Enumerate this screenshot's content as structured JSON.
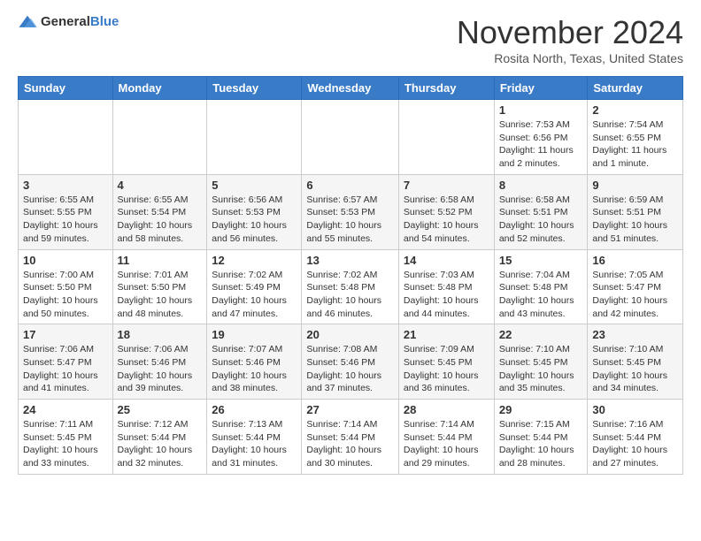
{
  "header": {
    "logo_general": "General",
    "logo_blue": "Blue",
    "month": "November 2024",
    "location": "Rosita North, Texas, United States"
  },
  "days_of_week": [
    "Sunday",
    "Monday",
    "Tuesday",
    "Wednesday",
    "Thursday",
    "Friday",
    "Saturday"
  ],
  "weeks": [
    [
      {
        "day": "",
        "info": ""
      },
      {
        "day": "",
        "info": ""
      },
      {
        "day": "",
        "info": ""
      },
      {
        "day": "",
        "info": ""
      },
      {
        "day": "",
        "info": ""
      },
      {
        "day": "1",
        "info": "Sunrise: 7:53 AM\nSunset: 6:56 PM\nDaylight: 11 hours and 2 minutes."
      },
      {
        "day": "2",
        "info": "Sunrise: 7:54 AM\nSunset: 6:55 PM\nDaylight: 11 hours and 1 minute."
      }
    ],
    [
      {
        "day": "3",
        "info": "Sunrise: 6:55 AM\nSunset: 5:55 PM\nDaylight: 10 hours and 59 minutes."
      },
      {
        "day": "4",
        "info": "Sunrise: 6:55 AM\nSunset: 5:54 PM\nDaylight: 10 hours and 58 minutes."
      },
      {
        "day": "5",
        "info": "Sunrise: 6:56 AM\nSunset: 5:53 PM\nDaylight: 10 hours and 56 minutes."
      },
      {
        "day": "6",
        "info": "Sunrise: 6:57 AM\nSunset: 5:53 PM\nDaylight: 10 hours and 55 minutes."
      },
      {
        "day": "7",
        "info": "Sunrise: 6:58 AM\nSunset: 5:52 PM\nDaylight: 10 hours and 54 minutes."
      },
      {
        "day": "8",
        "info": "Sunrise: 6:58 AM\nSunset: 5:51 PM\nDaylight: 10 hours and 52 minutes."
      },
      {
        "day": "9",
        "info": "Sunrise: 6:59 AM\nSunset: 5:51 PM\nDaylight: 10 hours and 51 minutes."
      }
    ],
    [
      {
        "day": "10",
        "info": "Sunrise: 7:00 AM\nSunset: 5:50 PM\nDaylight: 10 hours and 50 minutes."
      },
      {
        "day": "11",
        "info": "Sunrise: 7:01 AM\nSunset: 5:50 PM\nDaylight: 10 hours and 48 minutes."
      },
      {
        "day": "12",
        "info": "Sunrise: 7:02 AM\nSunset: 5:49 PM\nDaylight: 10 hours and 47 minutes."
      },
      {
        "day": "13",
        "info": "Sunrise: 7:02 AM\nSunset: 5:48 PM\nDaylight: 10 hours and 46 minutes."
      },
      {
        "day": "14",
        "info": "Sunrise: 7:03 AM\nSunset: 5:48 PM\nDaylight: 10 hours and 44 minutes."
      },
      {
        "day": "15",
        "info": "Sunrise: 7:04 AM\nSunset: 5:48 PM\nDaylight: 10 hours and 43 minutes."
      },
      {
        "day": "16",
        "info": "Sunrise: 7:05 AM\nSunset: 5:47 PM\nDaylight: 10 hours and 42 minutes."
      }
    ],
    [
      {
        "day": "17",
        "info": "Sunrise: 7:06 AM\nSunset: 5:47 PM\nDaylight: 10 hours and 41 minutes."
      },
      {
        "day": "18",
        "info": "Sunrise: 7:06 AM\nSunset: 5:46 PM\nDaylight: 10 hours and 39 minutes."
      },
      {
        "day": "19",
        "info": "Sunrise: 7:07 AM\nSunset: 5:46 PM\nDaylight: 10 hours and 38 minutes."
      },
      {
        "day": "20",
        "info": "Sunrise: 7:08 AM\nSunset: 5:46 PM\nDaylight: 10 hours and 37 minutes."
      },
      {
        "day": "21",
        "info": "Sunrise: 7:09 AM\nSunset: 5:45 PM\nDaylight: 10 hours and 36 minutes."
      },
      {
        "day": "22",
        "info": "Sunrise: 7:10 AM\nSunset: 5:45 PM\nDaylight: 10 hours and 35 minutes."
      },
      {
        "day": "23",
        "info": "Sunrise: 7:10 AM\nSunset: 5:45 PM\nDaylight: 10 hours and 34 minutes."
      }
    ],
    [
      {
        "day": "24",
        "info": "Sunrise: 7:11 AM\nSunset: 5:45 PM\nDaylight: 10 hours and 33 minutes."
      },
      {
        "day": "25",
        "info": "Sunrise: 7:12 AM\nSunset: 5:44 PM\nDaylight: 10 hours and 32 minutes."
      },
      {
        "day": "26",
        "info": "Sunrise: 7:13 AM\nSunset: 5:44 PM\nDaylight: 10 hours and 31 minutes."
      },
      {
        "day": "27",
        "info": "Sunrise: 7:14 AM\nSunset: 5:44 PM\nDaylight: 10 hours and 30 minutes."
      },
      {
        "day": "28",
        "info": "Sunrise: 7:14 AM\nSunset: 5:44 PM\nDaylight: 10 hours and 29 minutes."
      },
      {
        "day": "29",
        "info": "Sunrise: 7:15 AM\nSunset: 5:44 PM\nDaylight: 10 hours and 28 minutes."
      },
      {
        "day": "30",
        "info": "Sunrise: 7:16 AM\nSunset: 5:44 PM\nDaylight: 10 hours and 27 minutes."
      }
    ]
  ]
}
